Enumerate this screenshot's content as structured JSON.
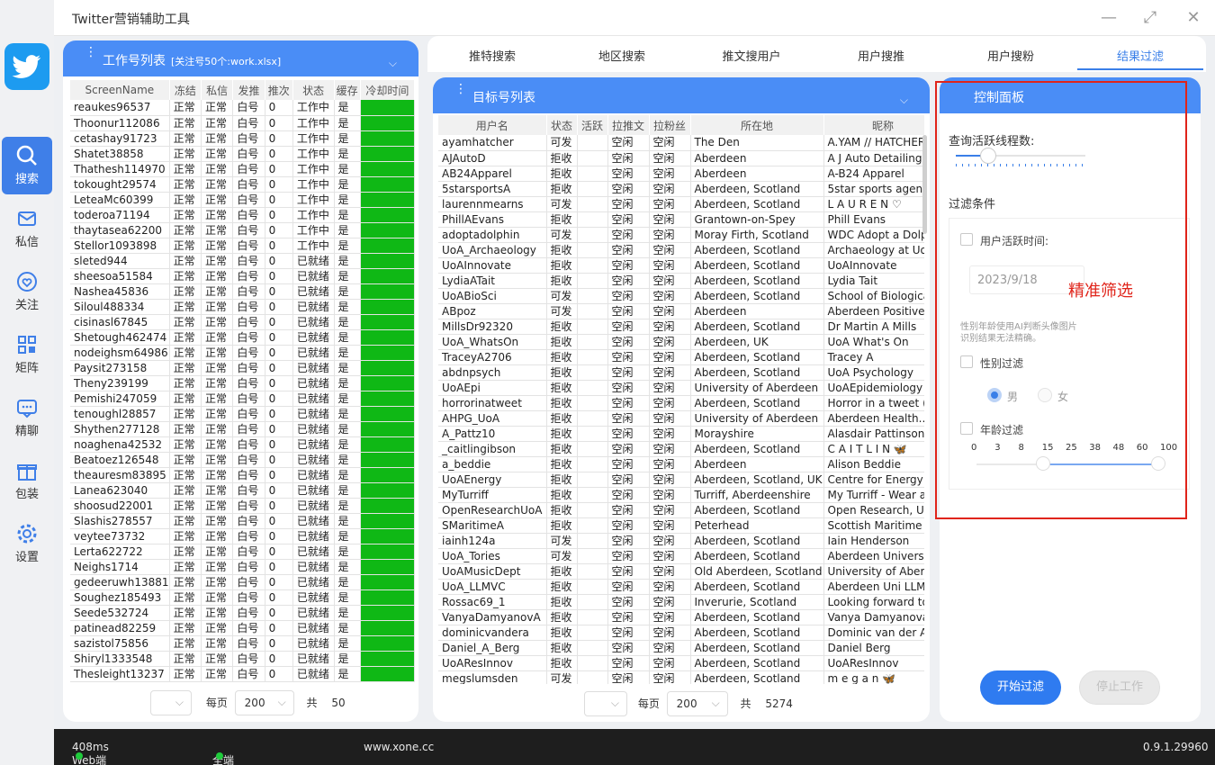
{
  "window": {
    "title": "Twitter营销辅助工具",
    "minimize": "—",
    "maximize": "⤢",
    "close": "✕"
  },
  "nav": [
    {
      "label": "搜索",
      "icon": "search-icon",
      "active": true
    },
    {
      "label": "私信",
      "icon": "mail-icon",
      "active": false
    },
    {
      "label": "关注",
      "icon": "heart-icon",
      "active": false
    },
    {
      "label": "矩阵",
      "icon": "grid-icon",
      "active": false
    },
    {
      "label": "精聊",
      "icon": "chat-icon",
      "active": false
    },
    {
      "label": "包装",
      "icon": "gift-icon",
      "active": false
    },
    {
      "label": "设置",
      "icon": "gear-icon",
      "active": false
    }
  ],
  "work_panel": {
    "title": "工作号列表",
    "subtitle": "[关注号50个:work.xlsx]",
    "headers": [
      "ScreenName",
      "冻结",
      "私信",
      "发推",
      "推次",
      "状态",
      "缓存",
      "冷却时间"
    ],
    "rows": [
      [
        "reaukes96537",
        "正常",
        "正常",
        "白号",
        "0",
        "工作中",
        "是"
      ],
      [
        "Thoonur112086",
        "正常",
        "正常",
        "白号",
        "0",
        "工作中",
        "是"
      ],
      [
        "cetashay91723",
        "正常",
        "正常",
        "白号",
        "0",
        "工作中",
        "是"
      ],
      [
        "Shatet38858",
        "正常",
        "正常",
        "白号",
        "0",
        "工作中",
        "是"
      ],
      [
        "Thathesh114970",
        "正常",
        "正常",
        "白号",
        "0",
        "工作中",
        "是"
      ],
      [
        "tokought29574",
        "正常",
        "正常",
        "白号",
        "0",
        "工作中",
        "是"
      ],
      [
        "LeteaMc60399",
        "正常",
        "正常",
        "白号",
        "0",
        "工作中",
        "是"
      ],
      [
        "toderoa71194",
        "正常",
        "正常",
        "白号",
        "0",
        "工作中",
        "是"
      ],
      [
        "thaytasea62200",
        "正常",
        "正常",
        "白号",
        "0",
        "工作中",
        "是"
      ],
      [
        "Stellor1093898",
        "正常",
        "正常",
        "白号",
        "0",
        "工作中",
        "是"
      ],
      [
        "sleted944",
        "正常",
        "正常",
        "白号",
        "0",
        "已就绪",
        "是"
      ],
      [
        "sheesoa51584",
        "正常",
        "正常",
        "白号",
        "0",
        "已就绪",
        "是"
      ],
      [
        "Nashea45836",
        "正常",
        "正常",
        "白号",
        "0",
        "已就绪",
        "是"
      ],
      [
        "Siloul488334",
        "正常",
        "正常",
        "白号",
        "0",
        "已就绪",
        "是"
      ],
      [
        "cisinasl67845",
        "正常",
        "正常",
        "白号",
        "0",
        "已就绪",
        "是"
      ],
      [
        "Shetough462474",
        "正常",
        "正常",
        "白号",
        "0",
        "已就绪",
        "是"
      ],
      [
        "nodeighsm64986",
        "正常",
        "正常",
        "白号",
        "0",
        "已就绪",
        "是"
      ],
      [
        "Paysit273158",
        "正常",
        "正常",
        "白号",
        "0",
        "已就绪",
        "是"
      ],
      [
        "Theny239199",
        "正常",
        "正常",
        "白号",
        "0",
        "已就绪",
        "是"
      ],
      [
        "Pemishi247059",
        "正常",
        "正常",
        "白号",
        "0",
        "已就绪",
        "是"
      ],
      [
        "tenoughl28857",
        "正常",
        "正常",
        "白号",
        "0",
        "已就绪",
        "是"
      ],
      [
        "Shythen277128",
        "正常",
        "正常",
        "白号",
        "0",
        "已就绪",
        "是"
      ],
      [
        "noaghena42532",
        "正常",
        "正常",
        "白号",
        "0",
        "已就绪",
        "是"
      ],
      [
        "Beatoez126548",
        "正常",
        "正常",
        "白号",
        "0",
        "已就绪",
        "是"
      ],
      [
        "theauresm83895",
        "正常",
        "正常",
        "白号",
        "0",
        "已就绪",
        "是"
      ],
      [
        "Lanea623040",
        "正常",
        "正常",
        "白号",
        "0",
        "已就绪",
        "是"
      ],
      [
        "shoosud22001",
        "正常",
        "正常",
        "白号",
        "0",
        "已就绪",
        "是"
      ],
      [
        "Slashis278557",
        "正常",
        "正常",
        "白号",
        "0",
        "已就绪",
        "是"
      ],
      [
        "veytee73732",
        "正常",
        "正常",
        "白号",
        "0",
        "已就绪",
        "是"
      ],
      [
        "Lerta622722",
        "正常",
        "正常",
        "白号",
        "0",
        "已就绪",
        "是"
      ],
      [
        "Neighs1714",
        "正常",
        "正常",
        "白号",
        "0",
        "已就绪",
        "是"
      ],
      [
        "gedeeruwh13881",
        "正常",
        "正常",
        "白号",
        "0",
        "已就绪",
        "是"
      ],
      [
        "Soughez185493",
        "正常",
        "正常",
        "白号",
        "0",
        "已就绪",
        "是"
      ],
      [
        "Seede532724",
        "正常",
        "正常",
        "白号",
        "0",
        "已就绪",
        "是"
      ],
      [
        "patinead82259",
        "正常",
        "正常",
        "白号",
        "0",
        "已就绪",
        "是"
      ],
      [
        "sazistol75856",
        "正常",
        "正常",
        "白号",
        "0",
        "已就绪",
        "是"
      ],
      [
        "Shiryl1333548",
        "正常",
        "正常",
        "白号",
        "0",
        "已就绪",
        "是"
      ],
      [
        "Thesleight13237",
        "正常",
        "正常",
        "白号",
        "0",
        "已就绪",
        "是"
      ]
    ],
    "pager": {
      "per_page_label": "每页",
      "per_page": "200",
      "total_label": "共",
      "total": "50"
    }
  },
  "tabs": [
    {
      "label": "推特搜索",
      "active": false
    },
    {
      "label": "地区搜索",
      "active": false
    },
    {
      "label": "推文搜用户",
      "active": false
    },
    {
      "label": "用户搜推",
      "active": false
    },
    {
      "label": "用户搜粉",
      "active": false
    },
    {
      "label": "结果过滤",
      "active": true
    }
  ],
  "target_panel": {
    "title": "目标号列表",
    "headers": [
      "用户名",
      "状态",
      "活跃",
      "拉推文",
      "拉粉丝",
      "所在地",
      "昵称"
    ],
    "rows": [
      [
        "ayamhatcher",
        "可发",
        "",
        "空闲",
        "空闲",
        "The Den",
        "A.YAM // HATCHER"
      ],
      [
        "AJAutoD",
        "拒收",
        "",
        "空闲",
        "空闲",
        "Aberdeen",
        "A J Auto Detailing"
      ],
      [
        "AB24Apparel",
        "拒收",
        "",
        "空闲",
        "空闲",
        "Aberdeen",
        "A-B24 Apparel"
      ],
      [
        "5starsportsA",
        "拒收",
        "",
        "空闲",
        "空闲",
        "Aberdeen, Scotland",
        "5star sports agency"
      ],
      [
        "laurennmearns",
        "可发",
        "",
        "空闲",
        "空闲",
        "Aberdeen, Scotland",
        "L A U R E N ♡"
      ],
      [
        "PhillAEvans",
        "拒收",
        "",
        "空闲",
        "空闲",
        "Grantown-on-Spey",
        "Phill Evans"
      ],
      [
        "adoptadolphin",
        "可发",
        "",
        "空闲",
        "空闲",
        "Moray Firth, Scotland",
        "WDC Adopt a Dolphin"
      ],
      [
        "UoA_Archaeology",
        "拒收",
        "",
        "空闲",
        "空闲",
        "Aberdeen, Scotland",
        "Archaeology at UoA"
      ],
      [
        "UoAInnovate",
        "拒收",
        "",
        "空闲",
        "空闲",
        "Aberdeen, Scotland",
        "UoAInnovate"
      ],
      [
        "LydiaATait",
        "拒收",
        "",
        "空闲",
        "空闲",
        "Aberdeen, Scotland",
        "Lydia Tait"
      ],
      [
        "UoABioSci",
        "可发",
        "",
        "空闲",
        "空闲",
        "Aberdeen, Scotland",
        "School of Biological"
      ],
      [
        "ABpoz",
        "可发",
        "",
        "空闲",
        "空闲",
        "Aberdeen",
        "Aberdeen Positive"
      ],
      [
        "MillsDr92320",
        "拒收",
        "",
        "空闲",
        "空闲",
        "Aberdeen, Scotland",
        "Dr Martin A Mills"
      ],
      [
        "UoA_WhatsOn",
        "拒收",
        "",
        "空闲",
        "空闲",
        "Aberdeen, UK",
        "UoA What's On"
      ],
      [
        "TraceyA2706",
        "拒收",
        "",
        "空闲",
        "空闲",
        "Aberdeen, Scotland",
        "Tracey A"
      ],
      [
        "abdnpsych",
        "拒收",
        "",
        "空闲",
        "空闲",
        "Aberdeen, Scotland",
        "UoA Psychology"
      ],
      [
        "UoAEpi",
        "拒收",
        "",
        "空闲",
        "空闲",
        "University of Aberdeen",
        "UoAEpidemiology"
      ],
      [
        "horrorinatweet",
        "拒收",
        "",
        "空闲",
        "空闲",
        "Aberdeen, Scotland",
        "Horror in a tweet ("
      ],
      [
        "AHPG_UoA",
        "拒收",
        "",
        "空闲",
        "空闲",
        "University of Aberdeen",
        "Aberdeen Health..."
      ],
      [
        "A_Pattz10",
        "拒收",
        "",
        "空闲",
        "空闲",
        "Morayshire",
        "Alasdair Pattinson"
      ],
      [
        "_caitlingibson",
        "拒收",
        "",
        "空闲",
        "空闲",
        "Aberdeen, Scotland",
        "C A I T L I N 🦋"
      ],
      [
        "a_beddie",
        "拒收",
        "",
        "空闲",
        "空闲",
        "Aberdeen",
        "Alison Beddie"
      ],
      [
        "UoAEnergy",
        "拒收",
        "",
        "空闲",
        "空闲",
        "Aberdeen, Scotland, UK",
        "Centre for Energy T"
      ],
      [
        "MyTurriff",
        "拒收",
        "",
        "空闲",
        "空闲",
        "Turriff, Aberdeenshire",
        "My Turriff - Wear a"
      ],
      [
        "OpenResearchUoA",
        "拒收",
        "",
        "空闲",
        "空闲",
        "Aberdeen, Scotland",
        "Open Research, Uni"
      ],
      [
        "SMaritimeA",
        "拒收",
        "",
        "空闲",
        "空闲",
        "Peterhead",
        "Scottish Maritime A"
      ],
      [
        "iainh124a",
        "可发",
        "",
        "空闲",
        "空闲",
        "Aberdeen, Scotland",
        "Iain Henderson"
      ],
      [
        "UoA_Tories",
        "可发",
        "",
        "空闲",
        "空闲",
        "Aberdeen, Scotland",
        "Aberdeen Universit"
      ],
      [
        "UoAMusicDept",
        "拒收",
        "",
        "空闲",
        "空闲",
        "Old Aberdeen, Scotland",
        "University of Aberd"
      ],
      [
        "UoA_LLMVC",
        "拒收",
        "",
        "空闲",
        "空闲",
        "Aberdeen, Scotland",
        "Aberdeen Uni LLM"
      ],
      [
        "Rossac69_1",
        "拒收",
        "",
        "空闲",
        "空闲",
        "Inverurie, Scotland",
        "Looking forward to"
      ],
      [
        "VanyaDamyanovA",
        "拒收",
        "",
        "空闲",
        "空闲",
        "Aberdeen, Scotland",
        "Vanya Damyanova"
      ],
      [
        "dominicvandera",
        "拒收",
        "",
        "空闲",
        "空闲",
        "Aberdeen, Scotland",
        "Dominic van der A"
      ],
      [
        "Daniel_A_Berg",
        "拒收",
        "",
        "空闲",
        "空闲",
        "Aberdeen, Scotland",
        "Daniel Berg"
      ],
      [
        "UoAResInnov",
        "拒收",
        "",
        "空闲",
        "空闲",
        "Aberdeen, Scotland",
        "UoAResInnov"
      ],
      [
        "megslumsden",
        "可发",
        "",
        "空闲",
        "空闲",
        "Aberdeen, Scotland",
        "m e g a n 🦋"
      ]
    ],
    "pager": {
      "per_page_label": "每页",
      "per_page": "200",
      "total_label": "共",
      "total": "5274"
    }
  },
  "control": {
    "title": "控制面板",
    "threads_label": "查询活跃线程数:",
    "filter_label": "过滤条件",
    "active_time_label": "用户活跃时间:",
    "date_value": "2023/9/18",
    "annotation": "精准筛选",
    "annotation_color": "#e0241a",
    "note_line1": "性别年龄使用AI判断头像图片",
    "note_line2": "识别结果无法精确。",
    "gender_label": "性别过滤",
    "male": "男",
    "female": "女",
    "age_label": "年龄过滤",
    "age_ticks": [
      "0",
      "3",
      "8",
      "15",
      "25",
      "38",
      "48",
      "60",
      "100"
    ],
    "start_btn": "开始过滤",
    "stop_btn": "停止工作"
  },
  "statusbar": {
    "web_port": "Web端口：",
    "latency": "408ms",
    "all_port": "全端口：",
    "site": "www.xone.cc",
    "version": "0.9.1.29960"
  },
  "colors": {
    "accent": "#4a8df6",
    "cooldown": "#0fb815",
    "highlight_box": "#e0241a"
  }
}
